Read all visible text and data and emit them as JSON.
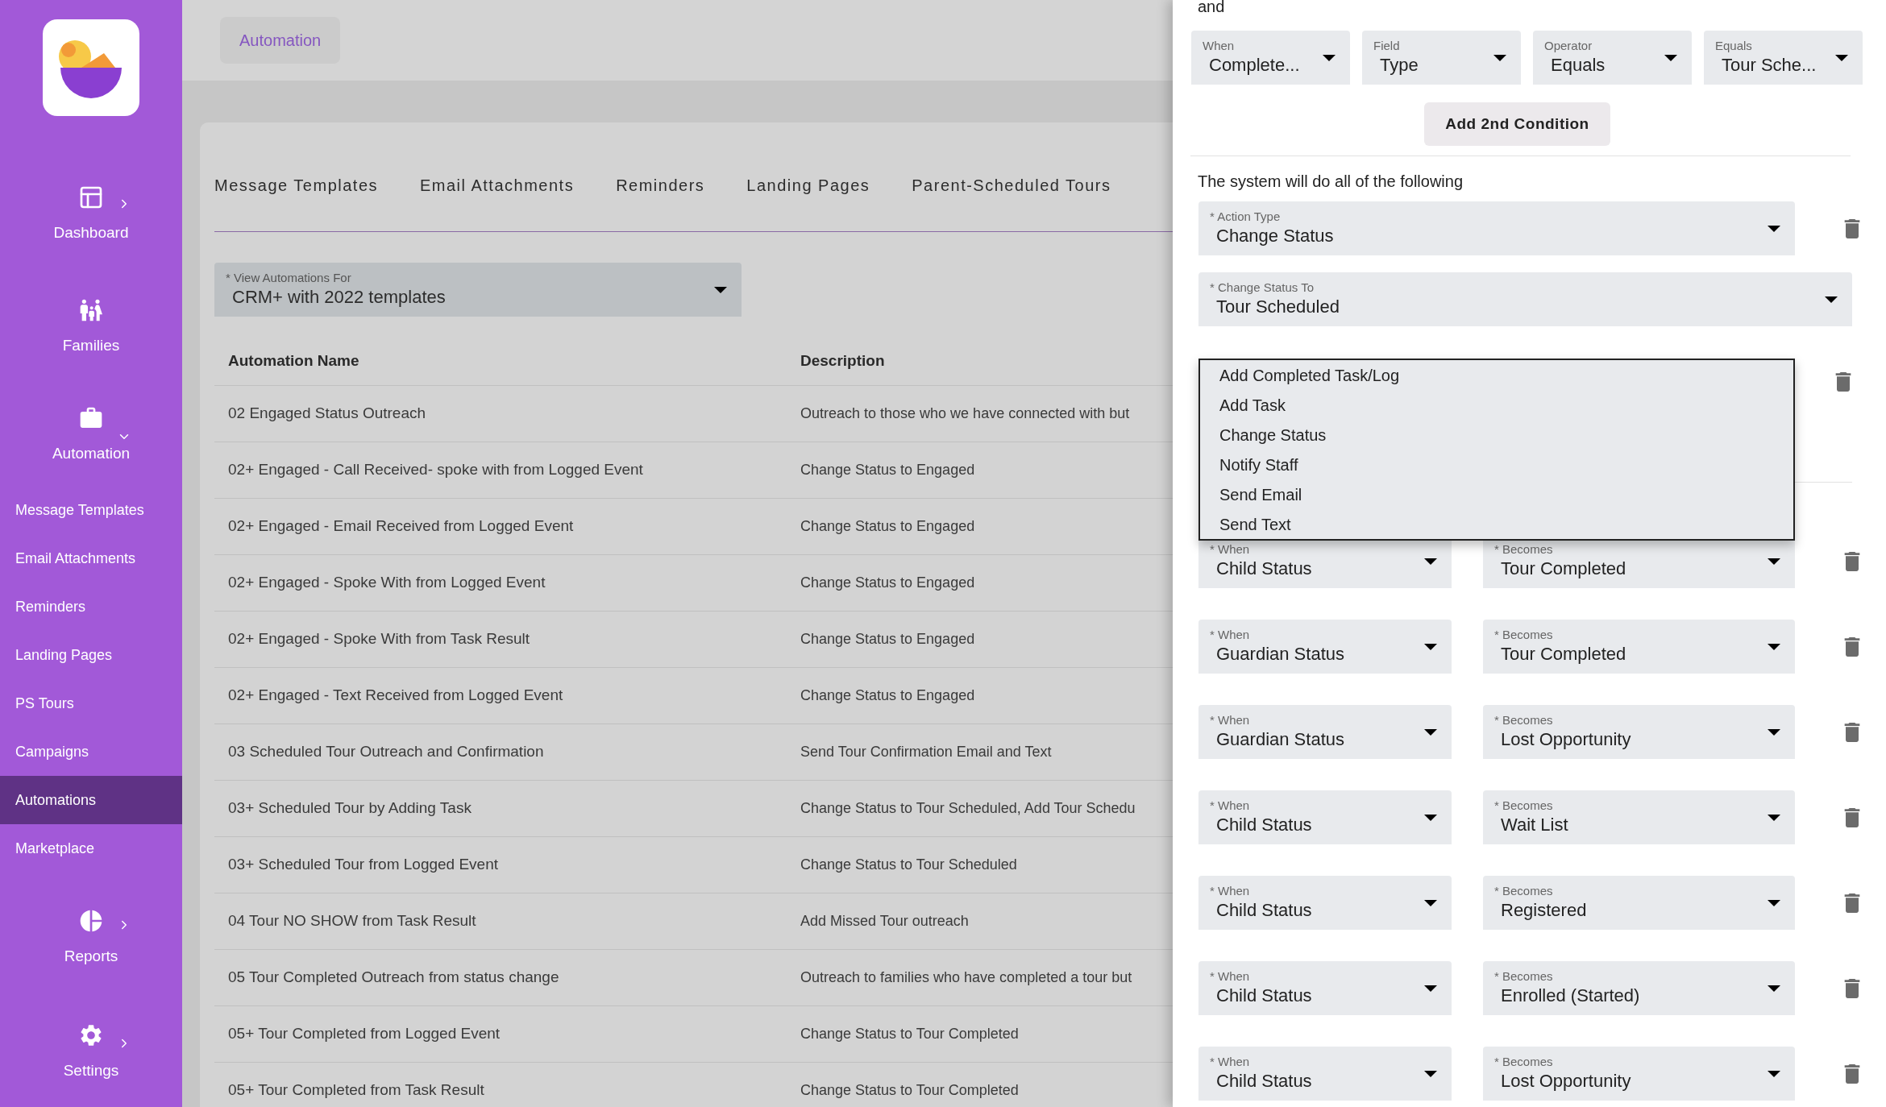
{
  "sidebar": {
    "sections": [
      {
        "label": "Dashboard",
        "expanded": false
      },
      {
        "label": "Families"
      },
      {
        "label": "Automation",
        "expanded": true,
        "children": [
          {
            "label": "Message Templates",
            "selected": false
          },
          {
            "label": "Email Attachments",
            "selected": false
          },
          {
            "label": "Reminders",
            "selected": false
          },
          {
            "label": "Landing Pages",
            "selected": false
          },
          {
            "label": "PS Tours",
            "selected": false
          },
          {
            "label": "Campaigns",
            "selected": false
          },
          {
            "label": "Automations",
            "selected": true
          },
          {
            "label": "Marketplace",
            "selected": false
          }
        ]
      },
      {
        "label": "Reports",
        "expanded": false
      },
      {
        "label": "Settings",
        "expanded": false
      }
    ]
  },
  "breadcrumb": "Automation",
  "tabs": [
    {
      "label": "Message Templates",
      "selected": false
    },
    {
      "label": "Email Attachments",
      "selected": false
    },
    {
      "label": "Reminders",
      "selected": false
    },
    {
      "label": "Landing Pages",
      "selected": false
    },
    {
      "label": "Parent-Scheduled Tours",
      "selected": false
    }
  ],
  "view_select": {
    "label": "* View Automations For",
    "value": "CRM+ with 2022 templates"
  },
  "table": {
    "columns": [
      "Automation Name",
      "Description"
    ],
    "rows": [
      [
        "02 Engaged Status Outreach",
        "Outreach to those who we have connected with but"
      ],
      [
        "02+ Engaged - Call Received- spoke with from Logged Event",
        "Change Status to Engaged"
      ],
      [
        "02+ Engaged - Email Received from Logged Event",
        "Change Status to Engaged"
      ],
      [
        "02+ Engaged - Spoke With from Logged Event",
        "Change Status to Engaged"
      ],
      [
        "02+ Engaged - Spoke With from Task Result",
        "Change Status to Engaged"
      ],
      [
        "02+ Engaged - Text Received from Logged Event",
        "Change Status to Engaged"
      ],
      [
        "03 Scheduled Tour Outreach and Confirmation",
        "Send Tour Confirmation Email and Text"
      ],
      [
        "03+ Scheduled Tour by Adding Task",
        "Change Status to Tour Scheduled, Add Tour Schedu"
      ],
      [
        "03+ Scheduled Tour from Logged Event",
        "Change Status to Tour Scheduled"
      ],
      [
        "04 Tour NO SHOW from Task Result",
        "Add Missed Tour outreach"
      ],
      [
        "05 Tour Completed Outreach from status change",
        "Outreach to families who have completed a tour but"
      ],
      [
        "05+ Tour Completed from Logged Event",
        "Change Status to Tour Completed"
      ],
      [
        "05+ Tour Completed from Task Result",
        "Change Status to Tour Completed"
      ]
    ]
  },
  "panel": {
    "conjunction": "and",
    "condition": [
      {
        "label": "When",
        "value": "Complete..."
      },
      {
        "label": "Field",
        "value": "Type"
      },
      {
        "label": "Operator",
        "value": "Equals"
      },
      {
        "label": "Equals",
        "value": "Tour Sche..."
      }
    ],
    "add_condition_button": "Add 2nd Condition",
    "actions_heading": "The system will do all of the following",
    "action_type": {
      "label": "* Action Type",
      "value": "Change Status"
    },
    "change_status_to": {
      "label": "* Change Status To",
      "value": "Tour Scheduled"
    },
    "action_menu": [
      {
        "label": "Add Completed Task/Log",
        "selected": false
      },
      {
        "label": "Add Task",
        "selected": false
      },
      {
        "label": "Change Status",
        "selected": false
      },
      {
        "label": "Notify Staff",
        "selected": false
      },
      {
        "label": "Send Email",
        "selected": false
      },
      {
        "label": "Send Text",
        "selected": false
      }
    ],
    "triggers": [
      {
        "when_label": "* When",
        "when": "Child Status",
        "becomes_label": "* Becomes",
        "becomes": "Tour Completed"
      },
      {
        "when_label": "* When",
        "when": "Guardian Status",
        "becomes_label": "* Becomes",
        "becomes": "Tour Completed"
      },
      {
        "when_label": "* When",
        "when": "Guardian Status",
        "becomes_label": "* Becomes",
        "becomes": "Lost Opportunity"
      },
      {
        "when_label": "* When",
        "when": "Child Status",
        "becomes_label": "* Becomes",
        "becomes": "Wait List"
      },
      {
        "when_label": "* When",
        "when": "Child Status",
        "becomes_label": "* Becomes",
        "becomes": "Registered"
      },
      {
        "when_label": "* When",
        "when": "Child Status",
        "becomes_label": "* Becomes",
        "becomes": "Enrolled (Started)"
      },
      {
        "when_label": "* When",
        "when": "Child Status",
        "becomes_label": "* Becomes",
        "becomes": "Lost Opportunity"
      }
    ]
  }
}
